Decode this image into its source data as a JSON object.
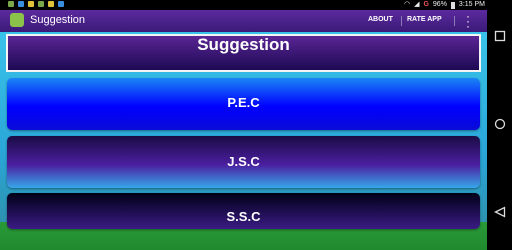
{
  "status_bar": {
    "battery": "96%",
    "time": "3:15 PM",
    "g_label": "G"
  },
  "action_bar": {
    "title": "Suggestion",
    "about_label": "ABOUT",
    "rate_label": "RATE APP",
    "background_color": "#4a2390"
  },
  "main": {
    "header_title": "Suggestion",
    "cards": [
      {
        "label": "P.E.C"
      },
      {
        "label": "J.S.C"
      },
      {
        "label": "S.S.C"
      }
    ],
    "accent_color": "#39c3ea"
  },
  "nav": {
    "back_icon": "back-triangle-icon",
    "home_icon": "home-circle-icon",
    "recents_icon": "recents-square-icon"
  }
}
